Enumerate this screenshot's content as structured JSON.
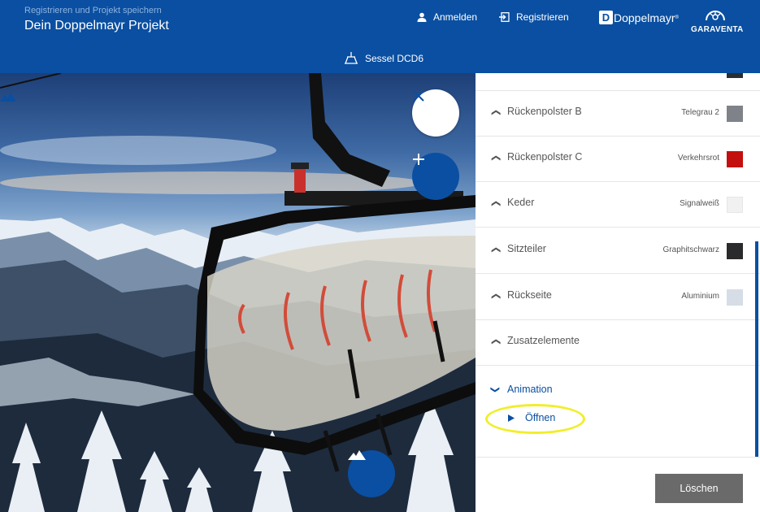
{
  "header": {
    "subtitle": "Registrieren und Projekt speichern",
    "title": "Dein Doppelmayr Projekt",
    "login_label": "Anmelden",
    "register_label": "Registrieren",
    "brand_doppelmayr": "Doppelmayr",
    "brand_garaventa": "GARAVENTA",
    "product_label": "Sessel DCD6",
    "background_color": "#0a4fa1"
  },
  "scene": {
    "close_icon": "close-icon",
    "add_icon": "plus-icon",
    "scene_icon": "mountain-icon"
  },
  "panel": {
    "rows": [
      {
        "label": "Rückenpolster B",
        "value": "Telegrau 2",
        "color": "#7f8389"
      },
      {
        "label": "Rückenpolster C",
        "value": "Verkehrsrot",
        "color": "#c40f0f"
      },
      {
        "label": "Keder",
        "value": "Signalweiß",
        "color": "#f1f1f1"
      },
      {
        "label": "Sitzteiler",
        "value": "Graphitschwarz",
        "color": "#2a2b2d"
      },
      {
        "label": "Rückseite",
        "value": "Aluminium",
        "color": "#d6dde6"
      },
      {
        "label": "Zusatzelemente",
        "value": "",
        "color": ""
      }
    ],
    "animation_label": "Animation",
    "open_label": "Öffnen",
    "delete_label": "Löschen"
  }
}
